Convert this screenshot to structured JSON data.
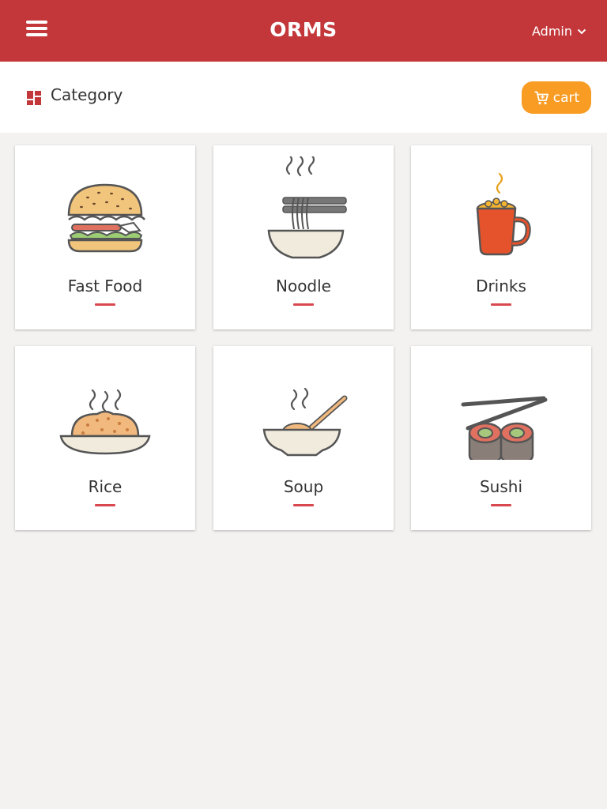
{
  "header": {
    "app_title": "ORMS",
    "user_label": "Admin",
    "background": "#c3373a"
  },
  "toolbar": {
    "section_title": "Category",
    "cart_label": "cart",
    "cart_color": "#f89c24"
  },
  "categories": [
    {
      "label": "Fast Food",
      "icon": "burger-icon"
    },
    {
      "label": "Noodle",
      "icon": "noodle-bowl-icon"
    },
    {
      "label": "Drinks",
      "icon": "coffee-mug-icon"
    },
    {
      "label": "Rice",
      "icon": "rice-plate-icon"
    },
    {
      "label": "Soup",
      "icon": "soup-bowl-icon"
    },
    {
      "label": "Sushi",
      "icon": "sushi-icon"
    }
  ]
}
